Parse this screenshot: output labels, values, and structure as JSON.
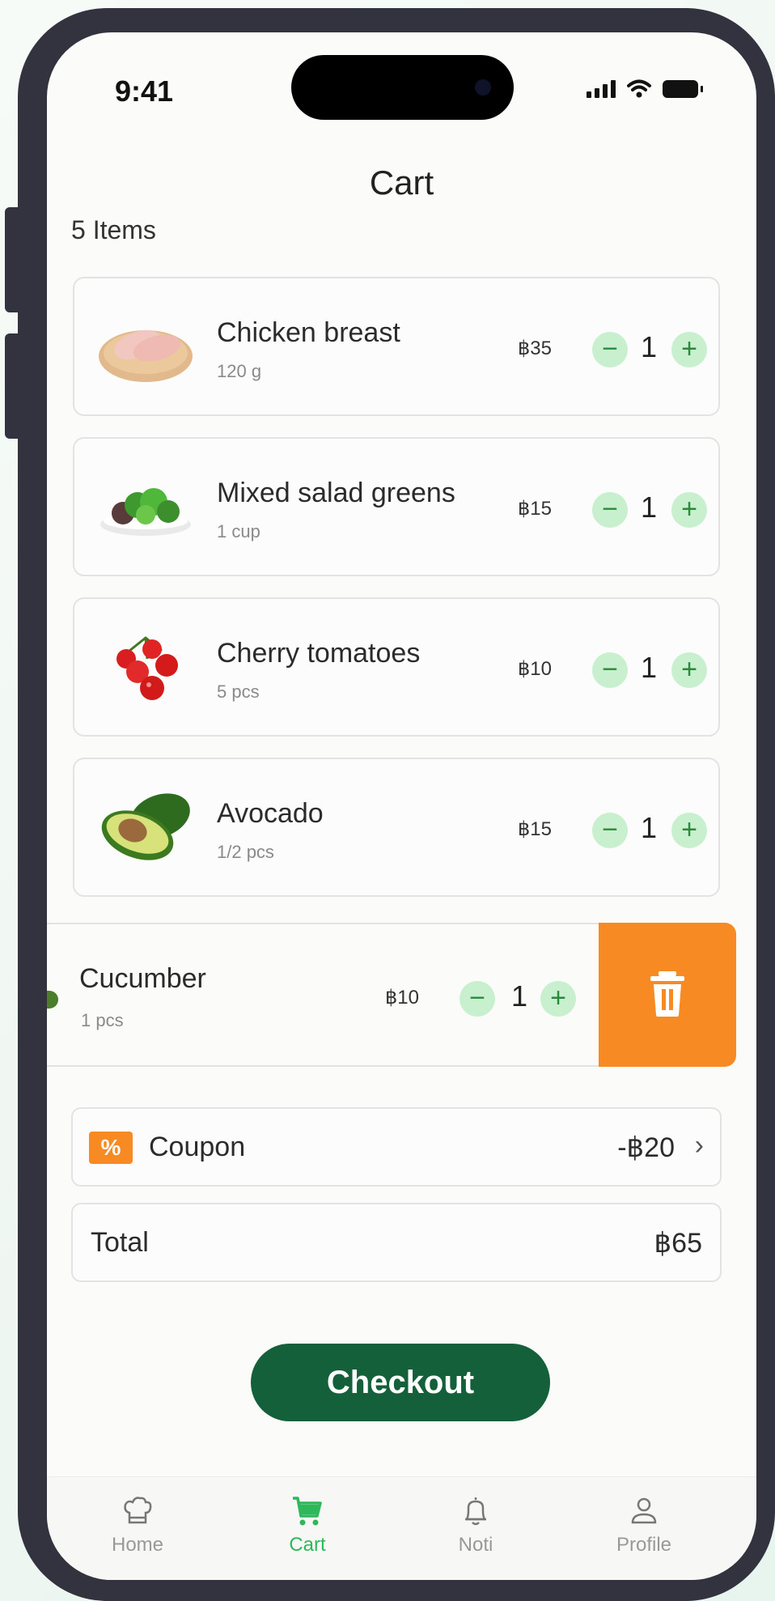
{
  "status_bar": {
    "time": "9:41"
  },
  "header": {
    "title": "Cart",
    "item_count": "5 Items"
  },
  "items": [
    {
      "name": "Chicken breast",
      "unit": "120 g",
      "price": "฿35",
      "qty": "1",
      "minus": "−",
      "plus": "+"
    },
    {
      "name": "Mixed salad greens",
      "unit": "1 cup",
      "price": "฿15",
      "qty": "1",
      "minus": "−",
      "plus": "+"
    },
    {
      "name": "Cherry tomatoes",
      "unit": "5 pcs",
      "price": "฿10",
      "qty": "1",
      "minus": "−",
      "plus": "+"
    },
    {
      "name": "Avocado",
      "unit": "1/2 pcs",
      "price": "฿15",
      "qty": "1",
      "minus": "−",
      "plus": "+"
    },
    {
      "name": "Cucumber",
      "unit": "1 pcs",
      "price": "฿10",
      "qty": "1",
      "minus": "−",
      "plus": "+"
    }
  ],
  "coupon": {
    "icon_text": "%",
    "label": "Coupon",
    "value": "-฿20",
    "chevron": "›"
  },
  "total": {
    "label": "Total",
    "value": "฿65"
  },
  "checkout": {
    "label": "Checkout"
  },
  "tabs": [
    {
      "label": "Home",
      "icon": "chef-hat-icon"
    },
    {
      "label": "Cart",
      "icon": "cart-icon"
    },
    {
      "label": "Noti",
      "icon": "bell-icon"
    },
    {
      "label": "Profile",
      "icon": "user-icon"
    }
  ],
  "colors": {
    "accent": "#13603b",
    "active_tab": "#2eb85c",
    "delete": "#f78a22",
    "qty_button_bg": "#c8f0cf"
  }
}
